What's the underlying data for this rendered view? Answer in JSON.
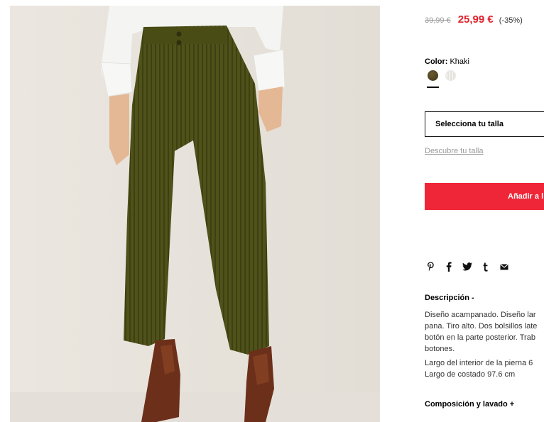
{
  "product": {
    "old_price": "39,99 €",
    "new_price": "25,99 €",
    "discount": "(-35%)"
  },
  "color": {
    "label": "Color:",
    "value": "Khaki",
    "swatches": [
      "khaki",
      "white"
    ],
    "selected": "khaki"
  },
  "size": {
    "select_label": "Selecciona tu talla",
    "guide_link": "Descubre tu talla"
  },
  "cart": {
    "add_label": "Añadir a l"
  },
  "share": {
    "icons": [
      "pinterest-icon",
      "facebook-icon",
      "twitter-icon",
      "tumblr-icon",
      "email-icon"
    ]
  },
  "description": {
    "title": "Descripción -",
    "lines": [
      "Diseño acampanado. Diseño lar",
      "pana. Tiro alto. Dos bolsillos late",
      "botón en la parte posterior. Trab",
      "botones."
    ],
    "measure_lines": [
      "Largo del interior de la pierna 6",
      "Largo de costado 97.6 cm"
    ]
  },
  "composition": {
    "title": "Composición y lavado +"
  },
  "colors": {
    "accent": "#e0212b",
    "button": "#ef2637",
    "muted": "#9a9a9a"
  }
}
